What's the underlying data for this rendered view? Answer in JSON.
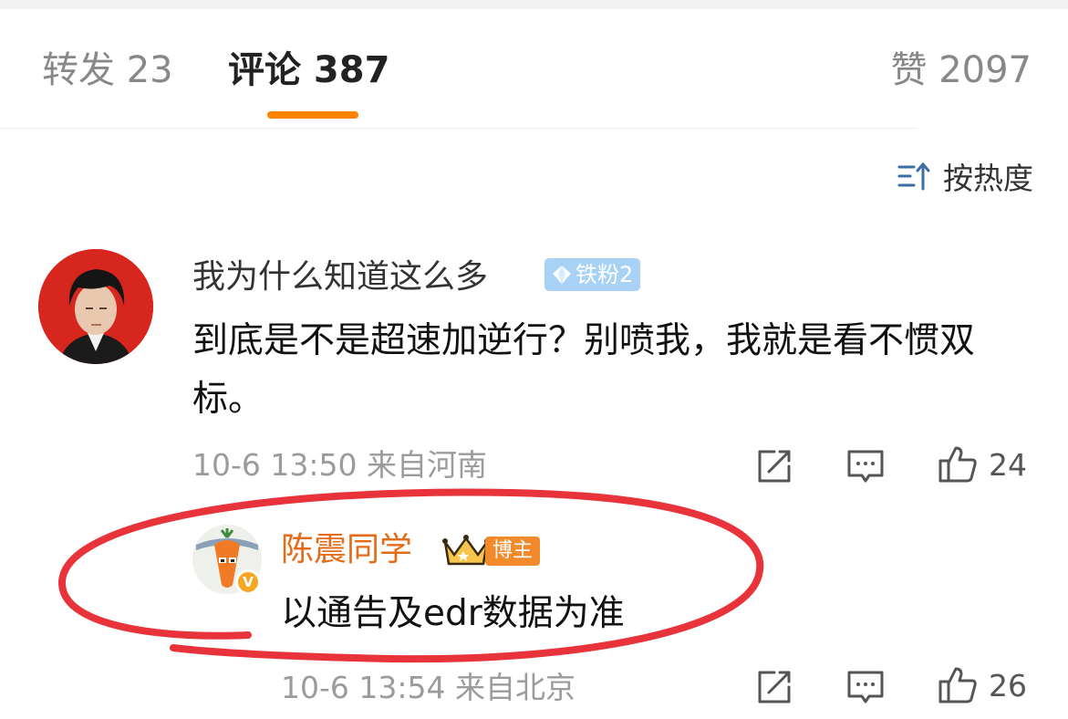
{
  "tabs": {
    "repost_label": "转发 23",
    "comments_label": "评论 387",
    "likes_label": "赞 2097",
    "active": "comments"
  },
  "sort": {
    "label": "按热度",
    "icon": "sort-icon"
  },
  "comments": [
    {
      "username": "我为什么知道这么多",
      "badge": "铁粉2",
      "content": "到底是不是超速加逆行？别喷我，我就是看不惯双标。",
      "time": "10-6 13:50",
      "location": "来自河南",
      "likes": "24"
    },
    {
      "username": "陈震同学",
      "badge": "博主",
      "verified": "V",
      "content": "以通告及edr数据为准",
      "time": "10-6 13:54",
      "location": "来自北京",
      "likes": "26"
    }
  ],
  "colors": {
    "accent": "#ff8200",
    "host_name": "#e56b17",
    "fan_badge": "#a7d1f5",
    "annotation": "#e8333a"
  }
}
